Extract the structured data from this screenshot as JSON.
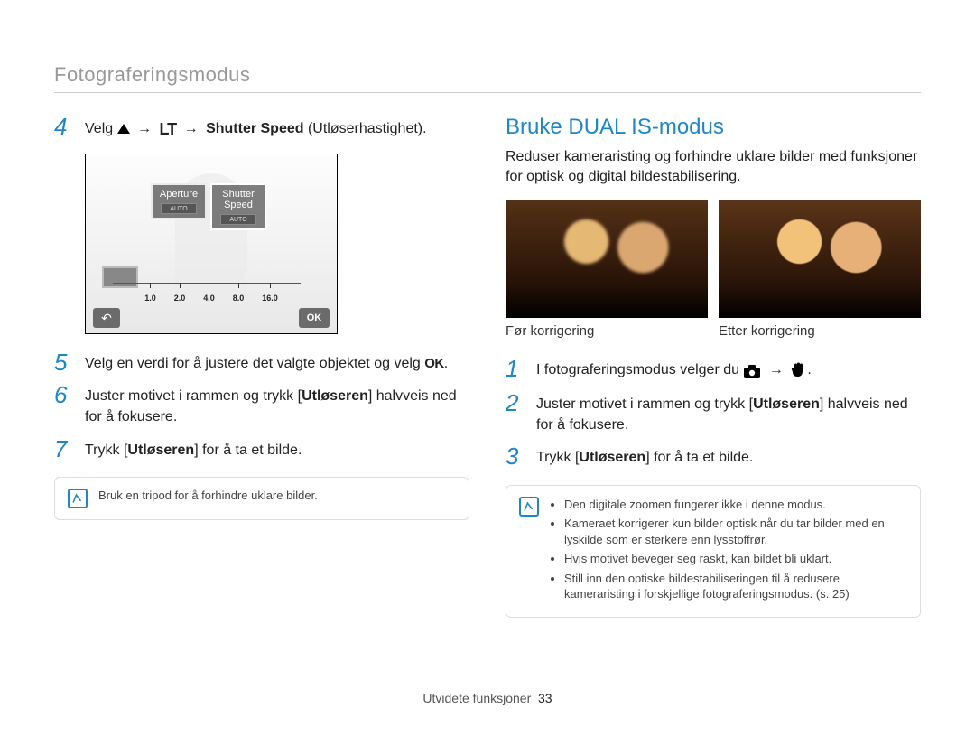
{
  "header": {
    "section_title": "Fotograferingsmodus"
  },
  "left": {
    "step4": {
      "num": "4",
      "prefix": "Velg",
      "arrow": "→",
      "boldLabel": "Shutter Speed",
      "rest": " (Utløserhastighet)."
    },
    "lcd": {
      "aperture_label": "Aperture",
      "shutter_label_line1": "Shutter",
      "shutter_label_line2": "Speed",
      "back": "↶",
      "ok": "OK",
      "scale": [
        "1.0",
        "2.0",
        "4.0",
        "8.0",
        "16.0"
      ]
    },
    "step5": {
      "num": "5",
      "text_before": "Velg en verdi for å justere det valgte objektet og velg ",
      "ok": "OK",
      "text_after": "."
    },
    "step6": {
      "num": "6",
      "text_before": "Juster motivet i rammen og trykk [",
      "bold": "Utløseren",
      "text_after": "] halvveis ned for å fokusere."
    },
    "step7": {
      "num": "7",
      "text_before": "Trykk [",
      "bold": "Utløseren",
      "text_after": "] for å ta et bilde."
    },
    "note": {
      "text": "Bruk en tripod for å forhindre uklare bilder."
    }
  },
  "right": {
    "heading": "Bruke DUAL IS-modus",
    "intro": "Reduser kameraristing og forhindre uklare bilder med funksjoner for optisk og digital bildestabilisering.",
    "before_label": "Før korrigering",
    "after_label": "Etter korrigering",
    "step1": {
      "num": "1",
      "text_before": "I fotograferingsmodus velger du ",
      "arrow": "→",
      "text_after": "."
    },
    "step2": {
      "num": "2",
      "text_before": "Juster motivet i rammen og trykk [",
      "bold": "Utløseren",
      "text_after": "] halvveis ned for å fokusere."
    },
    "step3": {
      "num": "3",
      "text_before": "Trykk [",
      "bold": "Utløseren",
      "text_after": "] for å ta et bilde."
    },
    "note": {
      "items": [
        "Den digitale zoomen fungerer ikke i denne modus.",
        "Kameraet korrigerer kun bilder optisk når du tar bilder med en lyskilde som er sterkere enn lysstoffrør.",
        "Hvis motivet beveger seg raskt, kan bildet bli uklart.",
        "Still inn den optiske bildestabiliseringen til å redusere kameraristing i forskjellige fotograferingsmodus. (s. 25)"
      ]
    }
  },
  "footer": {
    "label": "Utvidete funksjoner",
    "page": "33"
  }
}
